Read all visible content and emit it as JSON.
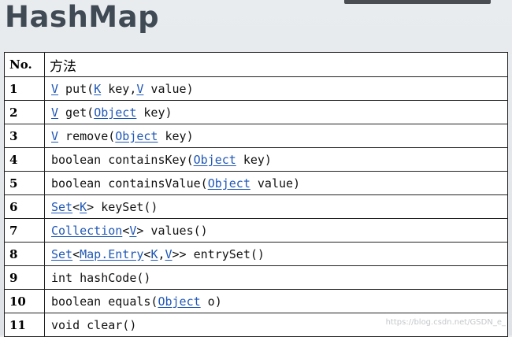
{
  "title": "HashMap",
  "table": {
    "headers": [
      "No.",
      "方法"
    ],
    "rows": [
      {
        "no": "1",
        "parts": [
          {
            "t": "V",
            "l": true
          },
          {
            "t": " put("
          },
          {
            "t": "K",
            "l": true
          },
          {
            "t": " key,"
          },
          {
            "t": "V",
            "l": true
          },
          {
            "t": " value)"
          }
        ]
      },
      {
        "no": "2",
        "parts": [
          {
            "t": "V",
            "l": true
          },
          {
            "t": " get("
          },
          {
            "t": "Object",
            "l": true
          },
          {
            "t": " key)"
          }
        ]
      },
      {
        "no": "3",
        "parts": [
          {
            "t": "V",
            "l": true
          },
          {
            "t": " remove("
          },
          {
            "t": "Object",
            "l": true
          },
          {
            "t": " key)"
          }
        ]
      },
      {
        "no": "4",
        "parts": [
          {
            "t": "boolean containsKey("
          },
          {
            "t": "Object",
            "l": true
          },
          {
            "t": " key)"
          }
        ]
      },
      {
        "no": "5",
        "parts": [
          {
            "t": "boolean containsValue("
          },
          {
            "t": "Object",
            "l": true
          },
          {
            "t": " value)"
          }
        ]
      },
      {
        "no": "6",
        "parts": [
          {
            "t": "Set",
            "l": true
          },
          {
            "t": "<"
          },
          {
            "t": "K",
            "l": true
          },
          {
            "t": "> keySet()"
          }
        ]
      },
      {
        "no": "7",
        "parts": [
          {
            "t": "Collection",
            "l": true
          },
          {
            "t": "<"
          },
          {
            "t": "V",
            "l": true
          },
          {
            "t": "> values()"
          }
        ]
      },
      {
        "no": "8",
        "parts": [
          {
            "t": "Set",
            "l": true
          },
          {
            "t": "<"
          },
          {
            "t": "Map.Entry",
            "l": true
          },
          {
            "t": "<"
          },
          {
            "t": "K",
            "l": true
          },
          {
            "t": ","
          },
          {
            "t": "V",
            "l": true
          },
          {
            "t": ">> entrySet()"
          }
        ]
      },
      {
        "no": "9",
        "parts": [
          {
            "t": "int hashCode()"
          }
        ]
      },
      {
        "no": "10",
        "parts": [
          {
            "t": "boolean equals("
          },
          {
            "t": "Object",
            "l": true
          },
          {
            "t": " o)"
          }
        ]
      },
      {
        "no": "11",
        "parts": [
          {
            "t": "void clear()"
          }
        ]
      }
    ]
  },
  "watermark": "https://blog.csdn.net/GSDN_e_"
}
